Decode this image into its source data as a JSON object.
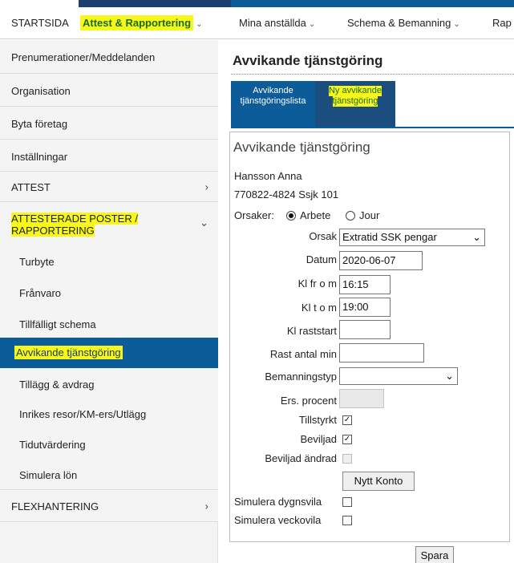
{
  "topnav": {
    "items": [
      {
        "label": "STARTSIDA",
        "highlighted": false
      },
      {
        "label": "Attest & Rapportering",
        "highlighted": true
      },
      {
        "label": "Mina anställda",
        "highlighted": false
      },
      {
        "label": "Schema & Bemanning",
        "highlighted": false
      },
      {
        "label": "Rap",
        "highlighted": false
      }
    ]
  },
  "sidebar": {
    "items": [
      {
        "label": "Prenumerationer/Meddelanden"
      },
      {
        "label": "Organisation"
      },
      {
        "label": "Byta företag"
      },
      {
        "label": "Inställningar"
      },
      {
        "label": "ATTEST"
      },
      {
        "label_line1": "ATTESTERADE POSTER /",
        "label_line2": "RAPPORTERING"
      },
      {
        "label": "FLEXHANTERING"
      }
    ],
    "subitems": [
      {
        "label": "Turbyte"
      },
      {
        "label": "Frånvaro"
      },
      {
        "label": "Tillfälligt schema"
      },
      {
        "label": "Avvikande tjänstgöring",
        "active": true
      },
      {
        "label": "Tillägg & avdrag"
      },
      {
        "label": "Inrikes resor/KM-ers/Utlägg"
      },
      {
        "label": "Tidutvärdering"
      },
      {
        "label": "Simulera lön"
      }
    ]
  },
  "main": {
    "page_title": "Avvikande tjänstgöring",
    "tabs": [
      {
        "line1": "Avvikande",
        "line2": "tjänstgöringslista"
      },
      {
        "line1": "Ny avvikande",
        "line2": "tjänstgöring",
        "highlighted": true
      }
    ],
    "panel_title": "Avvikande tjänstgöring",
    "person_name": "Hansson Anna",
    "person_id": "770822-4824 Ssjk 101",
    "orsaker": {
      "label": "Orsaker:",
      "option1": "Arbete",
      "option2": "Jour",
      "selected": "Arbete"
    },
    "form": {
      "orsak_label": "Orsak",
      "orsak_value": "Extratid SSK pengar",
      "datum_label": "Datum",
      "datum_value": "2020-06-07",
      "kl_from_label": "Kl fr o m",
      "kl_from_value": "16:15",
      "kl_tom_label": "Kl t o m",
      "kl_tom_value": "19:00",
      "raststart_label": "Kl raststart",
      "raststart_value": "",
      "rast_min_label": "Rast antal min",
      "rast_min_value": "",
      "bemanningstyp_label": "Bemanningstyp",
      "bemanningstyp_value": "",
      "ers_procent_label": "Ers. procent",
      "ers_procent_value": "",
      "tillstyrkt_label": "Tillstyrkt",
      "tillstyrkt_checked": true,
      "beviljad_label": "Beviljad",
      "beviljad_checked": true,
      "beviljad_andrad_label": "Beviljad ändrad",
      "beviljad_andrad_checked": false,
      "nytt_konto_label": "Nytt Konto",
      "sim_dygnsvila_label": "Simulera dygnsvila",
      "sim_dygnsvila_checked": false,
      "sim_veckovila_label": "Simulera veckovila",
      "sim_veckovila_checked": false
    },
    "save_label": "Spara"
  },
  "colors": {
    "accent_blue": "#0c5c9a",
    "dark_blue": "#1d3f6e",
    "highlight_yellow": "#f7f719",
    "sidebar_bg": "#f4f4f4"
  }
}
